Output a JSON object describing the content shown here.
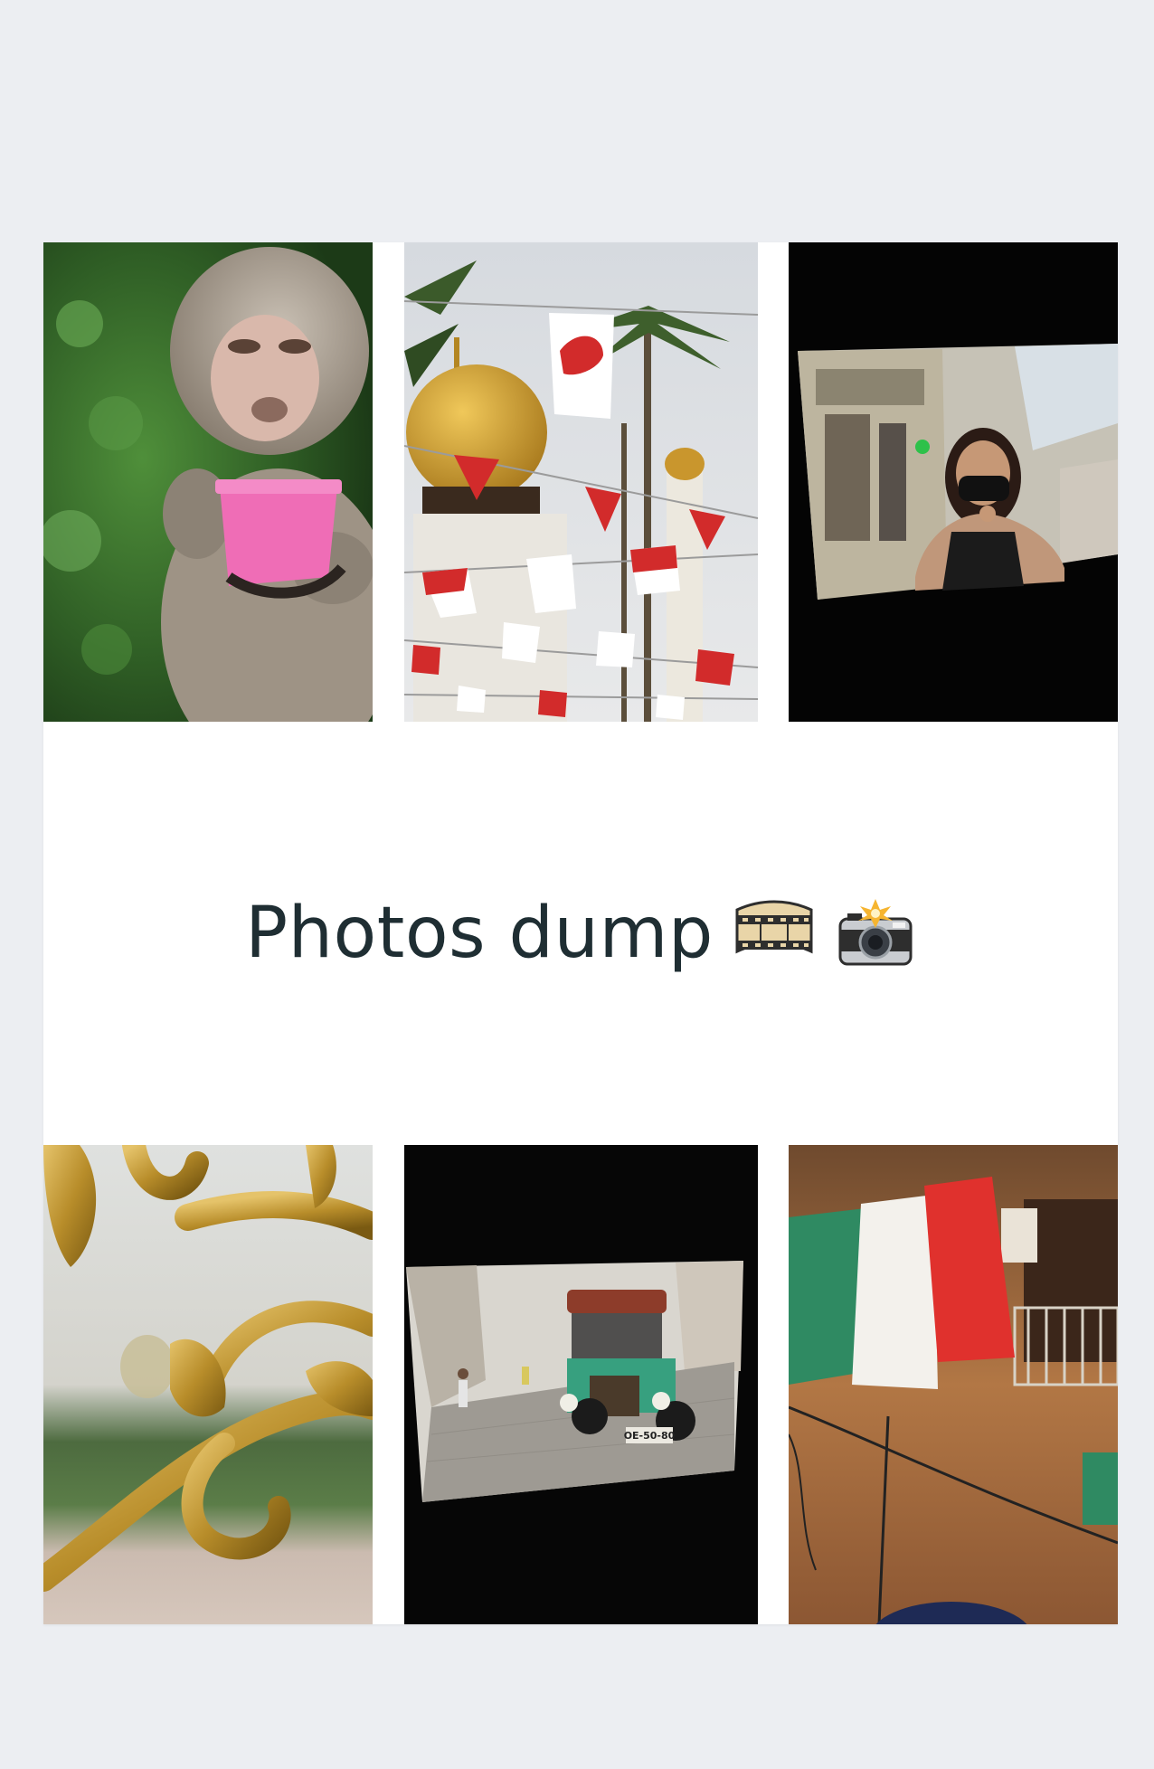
{
  "post": {
    "title": "Photos dump",
    "emojis": [
      "film-frames-emoji",
      "camera-with-flash-emoji"
    ]
  },
  "photos": [
    {
      "name": "monkey-with-pink-cup-photo"
    },
    {
      "name": "mosque-with-singapore-flags-photo"
    },
    {
      "name": "masked-woman-on-street-photo"
    },
    {
      "name": "golden-ornament-photo"
    },
    {
      "name": "vintage-green-car-photo",
      "plate": "OE-50-80"
    },
    {
      "name": "laundry-italian-colors-photo"
    }
  ]
}
